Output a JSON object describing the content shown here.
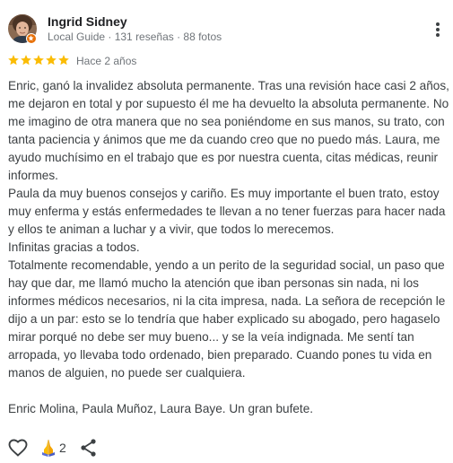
{
  "reviewer": {
    "name": "Ingrid Sidney",
    "meta": "Local Guide · 131 reseñas · 88 fotos",
    "avatar_icon": "user-avatar-photo",
    "badge_icon": "local-guide-star-badge",
    "badge_color": "#e8710a"
  },
  "rating": {
    "stars": 5,
    "max_stars": 5,
    "star_color": "#fbbc04",
    "date": "Hace 2 años"
  },
  "review": {
    "paragraphs": [
      "Enric, ganó la invalidez absoluta permanente. Tras una revisión hace casi 2 años, me dejaron en total y por supuesto él me ha devuelto la absoluta permanente. No me imagino de otra manera que no sea poniéndome en sus manos, su trato, con tanta paciencia y ánimos que me da cuando creo que no puedo más. Laura, me ayudo muchísimo en el trabajo que es por nuestra cuenta, citas médicas, reunir informes.",
      "Paula da muy buenos consejos y cariño. Es muy importante el buen trato, estoy muy enferma y estás enfermedades te llevan a no tener fuerzas para hacer nada y ellos te animan a luchar y a vivir, que todos lo merecemos.",
      "Infinitas gracias a todos.",
      "Totalmente recomendable, yendo a un perito de la seguridad social, un paso que hay que dar, me llamó mucho la atención que iban personas sin nada, ni los informes médicos necesarios, ni la cita impresa, nada. La señora de recepción le dijo a un par: esto se lo tendría que haber explicado su abogado, pero hagaselo mirar porqué no debe ser muy bueno... y se la veía indignada. Me sentí tan arropada, yo llevaba todo ordenado, bien preparado. Cuando pones tu vida en manos de alguien, no puede ser cualquiera.",
      "",
      "Enric Molina, Paula Muñoz, Laura Baye. Un gran bufete."
    ]
  },
  "actions": {
    "like_icon": "heart-outline-icon",
    "reaction_icon": "folded-hands-emoji",
    "reaction_count": "2",
    "share_icon": "share-icon",
    "more_icon": "more-vertical-icon"
  }
}
